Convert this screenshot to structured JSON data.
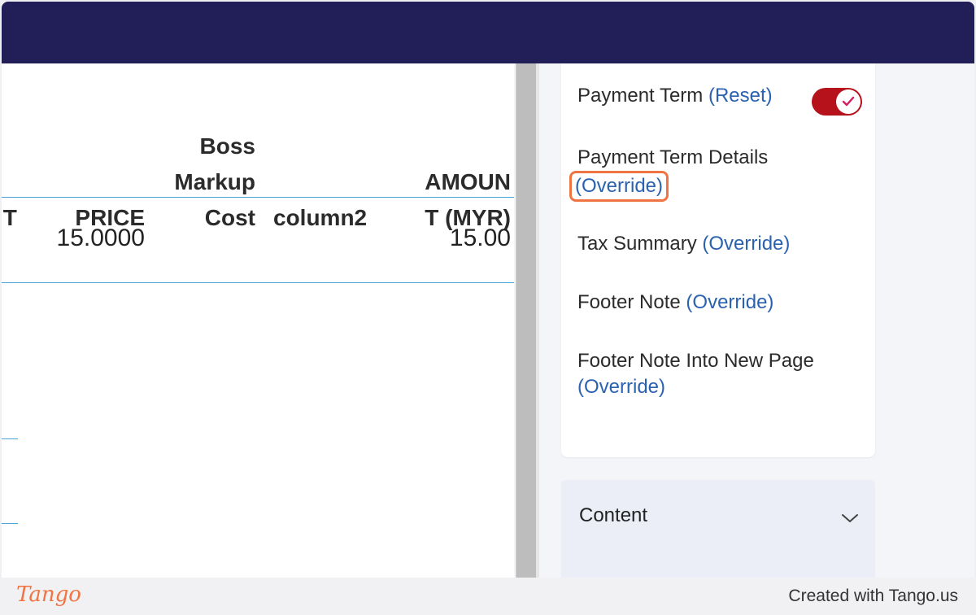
{
  "table": {
    "headers": {
      "unit": "IT",
      "price": "PRICE",
      "boss_markup_cost": "Boss\nMarkup\nCost",
      "column2": "column2",
      "amount": "AMOUN\nT (MYR)"
    },
    "rows": [
      {
        "price": "15.0000",
        "amount": "15.00"
      }
    ]
  },
  "panel": {
    "payment_term": {
      "label": "Payment Term",
      "link": "(Reset)",
      "toggle_on": true
    },
    "payment_term_details": {
      "label": "Payment Term Details",
      "link": "(Override)"
    },
    "tax_summary": {
      "label": "Tax Summary",
      "link": "(Override)"
    },
    "footer_note": {
      "label": "Footer Note",
      "link": "(Override)"
    },
    "footer_note_new_page": {
      "label": "Footer Note Into New Page",
      "link": "(Override)"
    }
  },
  "accordion": {
    "title": "Content",
    "icon": "chevron-down-icon"
  },
  "footer": {
    "brand": "Tango",
    "credit": "Created with Tango.us"
  },
  "colors": {
    "topbar": "#221e57",
    "link": "#2a62b0",
    "toggle": "#b5121b",
    "highlight": "#f07442",
    "table_rule": "#4aa3d8"
  }
}
